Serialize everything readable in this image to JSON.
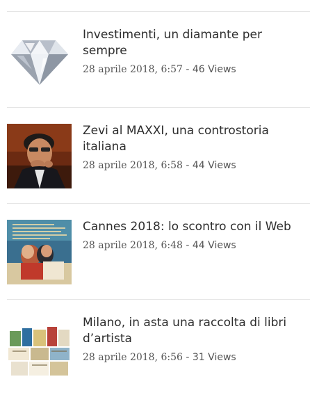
{
  "articles": [
    {
      "title": "Investimenti, un diamante per sempre",
      "date": "28 aprile 2018, 6:57",
      "separator": " - ",
      "views": "46",
      "views_label": " Views",
      "thumbnail_icon": "diamond-image"
    },
    {
      "title": "Zevi al MAXXI, una controstoria italiana",
      "date": "28 aprile 2018, 6:58",
      "separator": " - ",
      "views": "44",
      "views_label": " Views",
      "thumbnail_icon": "portrait-image"
    },
    {
      "title": "Cannes 2018: lo scontro con il Web",
      "date": "28 aprile 2018, 6:48",
      "separator": " - ",
      "views": "44",
      "views_label": " Views",
      "thumbnail_icon": "festival-poster-image"
    },
    {
      "title": "Milano, in asta una raccolta di libri d’artista",
      "date": "28 aprile 2018, 6:56",
      "separator": " - ",
      "views": "31",
      "views_label": " Views",
      "thumbnail_icon": "artist-books-image"
    }
  ],
  "colors": {
    "title": "#2d2d2d",
    "meta": "#555555",
    "divider": "#e5e5e5",
    "poster_blue": "#3a6f8f",
    "poster_teal": "#4f8ea8"
  }
}
